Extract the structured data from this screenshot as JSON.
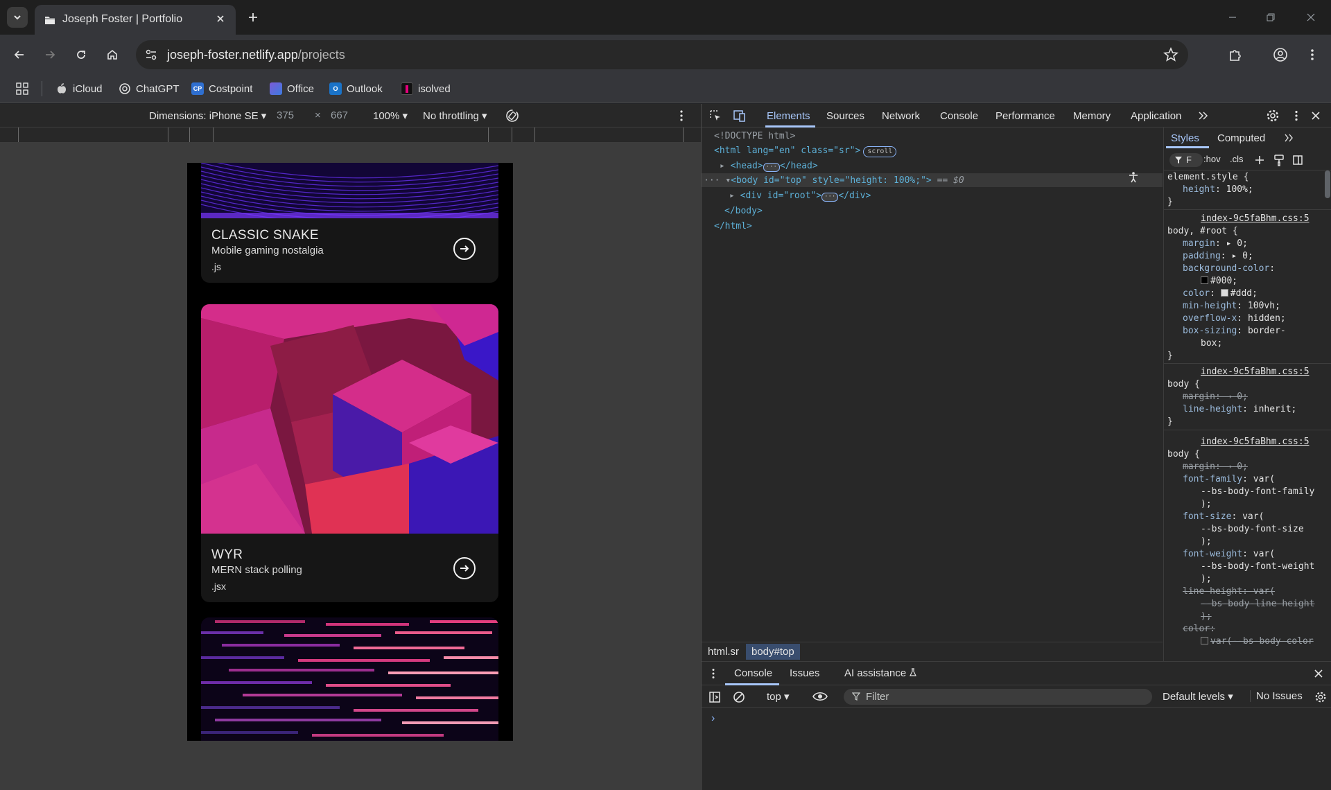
{
  "browser": {
    "tab_title": "Joseph Foster | Portfolio",
    "url_host": "joseph-foster.netlify.app",
    "url_path": "/projects",
    "bookmarks": [
      "iCloud",
      "ChatGPT",
      "Costpoint",
      "Office",
      "Outlook",
      "isolved"
    ]
  },
  "device_toolbar": {
    "dimensions_label": "Dimensions: iPhone SE",
    "width": "375",
    "times": "×",
    "height": "667",
    "zoom": "100%",
    "throttling": "No throttling"
  },
  "projects": [
    {
      "title": "CLASSIC SNAKE",
      "subtitle": "Mobile gaming nostalgia",
      "ext": ".js"
    },
    {
      "title": "WYR",
      "subtitle": "MERN stack polling",
      "ext": ".jsx"
    }
  ],
  "devtools": {
    "tabs": [
      "Elements",
      "Sources",
      "Network",
      "Console",
      "Performance",
      "Memory",
      "Application"
    ],
    "dom": {
      "doctype": "<!DOCTYPE html>",
      "html_open": "<html lang=\"en\" class=\"sr\">",
      "scroll_badge": "scroll",
      "head": "<head>",
      "head_close": "</head>",
      "body_open": "<body id=\"top\" style=\"height: 100%;\">",
      "eq": "== $0",
      "root_div": "<div id=\"root\">",
      "div_close": "</div>",
      "body_close": "</body>",
      "html_close": "</html>"
    },
    "breadcrumbs": [
      "html.sr",
      "body#top"
    ],
    "styles_tabs": [
      "Styles",
      "Computed"
    ],
    "filter_text": "F",
    "hov": ":hov",
    "cls": ".cls",
    "rules": {
      "element_style": "element.style {",
      "height_prop": "height",
      "height_val": "100%;",
      "src": "index-9c5faBhm.css:5",
      "sel1": "body, #root {",
      "margin": "margin",
      "margin_val": "0;",
      "padding": "padding",
      "padding_val": "0;",
      "bg": "background-color",
      "bg_val": "#000;",
      "color": "color",
      "color_val": "#ddd;",
      "minh": "min-height",
      "minh_val": "100vh;",
      "ovx": "overflow-x",
      "ovx_val": "hidden;",
      "boxs": "box-sizing",
      "boxs_val": "border-",
      "boxs_val2": "box;",
      "close": "}",
      "sel2": "body {",
      "lh": "line-height",
      "lh_val": "inherit;",
      "ff": "font-family",
      "ff_var": "--bs-body-font-family",
      "fs": "font-size",
      "fs_var": "--bs-body-font-size",
      "fw": "font-weight",
      "fw_var": "--bs-body-font-weight",
      "lh_var": "--bs-body-line-height",
      "color_var": "var(--bs-body-color",
      "var_open": "var(",
      "var_close": ");",
      "colon": ":",
      "margin_struck": "margin: → 0;",
      "lh_struck": "line-height: var(",
      "color_struck": "color:"
    },
    "drawer": {
      "tabs": [
        "Console",
        "Issues",
        "AI assistance"
      ],
      "context": "top",
      "filter_placeholder": "Filter",
      "levels": "Default levels",
      "issues": "No Issues",
      "prompt": "›"
    }
  }
}
